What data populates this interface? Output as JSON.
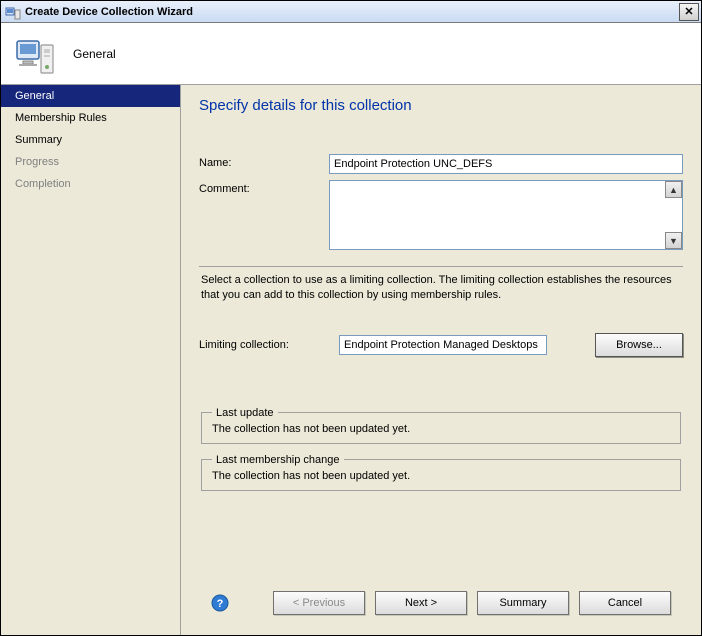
{
  "window": {
    "title": "Create Device Collection Wizard"
  },
  "header": {
    "pageTitle": "General"
  },
  "sidebar": {
    "items": [
      {
        "label": "General",
        "selected": true
      },
      {
        "label": "Membership Rules"
      },
      {
        "label": "Summary"
      },
      {
        "label": "Progress",
        "disabled": true
      },
      {
        "label": "Completion",
        "disabled": true
      }
    ]
  },
  "main": {
    "heading": "Specify details for this collection",
    "nameLabel": "Name:",
    "nameValue": "Endpoint Protection UNC_DEFS",
    "commentLabel": "Comment:",
    "helpText": "Select a collection to use as a limiting collection. The limiting collection establishes the resources that you can add to this collection by using membership rules.",
    "limitingLabel": "Limiting collection:",
    "limitingValue": "Endpoint Protection Managed Desktops",
    "browseLabel": "Browse...",
    "lastUpdateLegend": "Last update",
    "lastUpdateText": "The collection has not been updated yet.",
    "lastMembershipLegend": "Last membership change",
    "lastMembershipText": "The collection has not been updated yet."
  },
  "footer": {
    "previous": "< Previous",
    "next": "Next >",
    "summary": "Summary",
    "cancel": "Cancel"
  }
}
